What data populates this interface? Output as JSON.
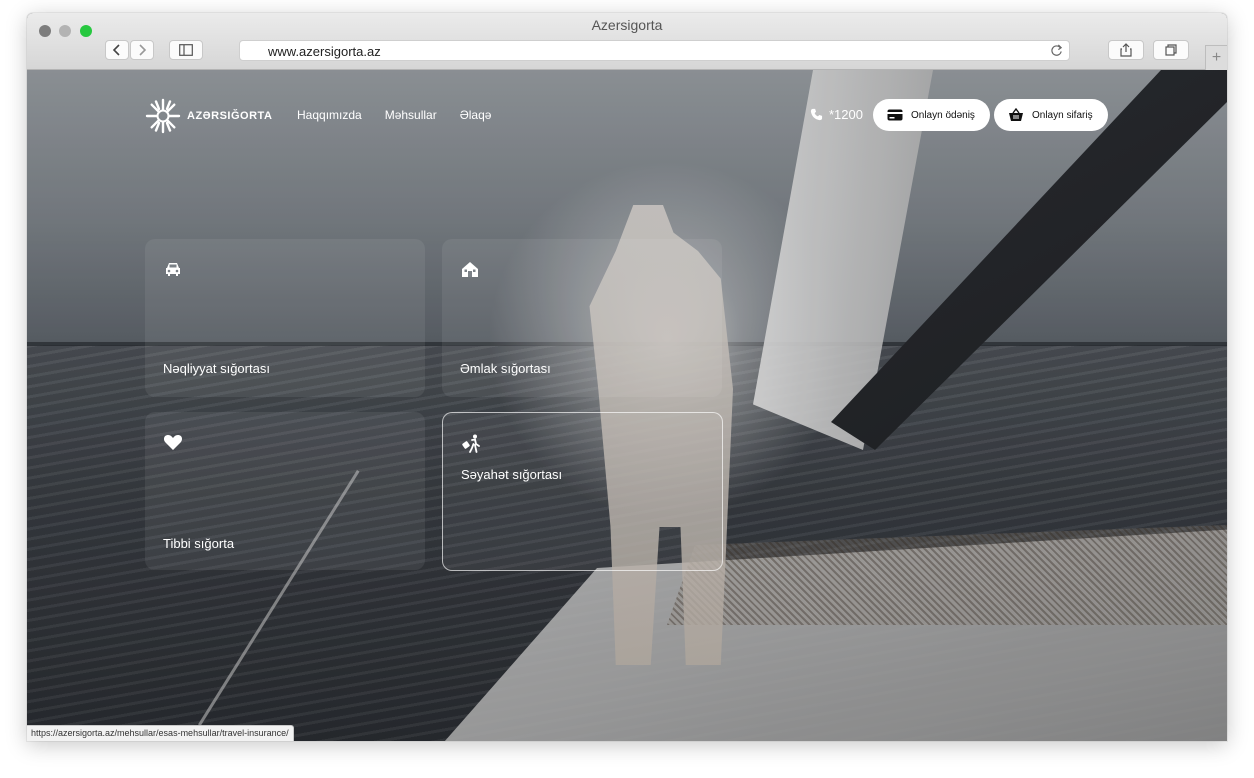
{
  "browser": {
    "window_title": "Azersigorta",
    "url": "www.azersigorta.az",
    "status_url": "https://azersigorta.az/mehsullar/esas-mehsullar/travel-insurance/"
  },
  "site": {
    "logo_text": "AZƏRSIĞORTA",
    "nav": [
      "Haqqımızda",
      "Məhsullar",
      "Əlaqə"
    ],
    "phone": "*1200",
    "online_payment": "Onlayn ödəniş",
    "online_order": "Onlayn sifariş"
  },
  "cards": [
    {
      "label": "Nəqliyyat sığortası",
      "icon": "car-icon"
    },
    {
      "label": "Əmlak sığortası",
      "icon": "house-icon"
    },
    {
      "label": "Tibbi sığorta",
      "icon": "heart-icon"
    },
    {
      "label": "Səyahət sığortası",
      "icon": "traveler-icon"
    }
  ]
}
